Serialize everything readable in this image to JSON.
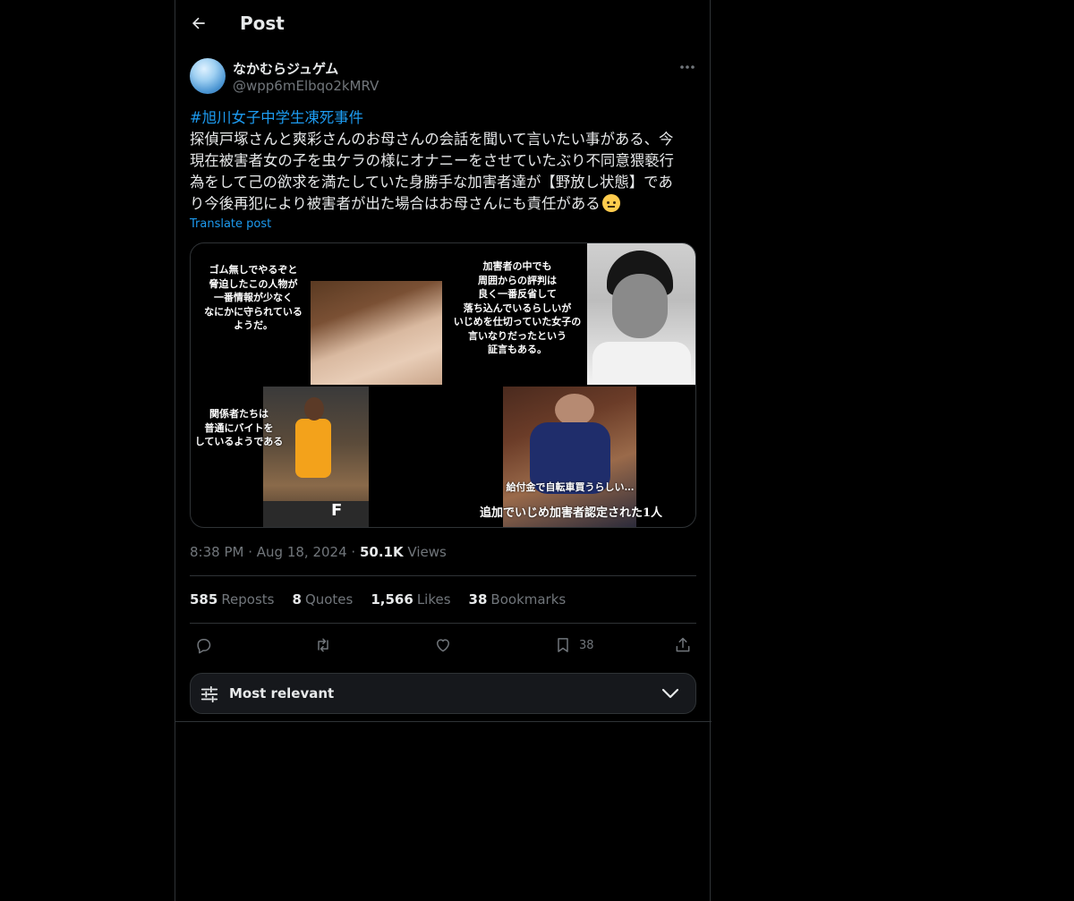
{
  "header": {
    "title": "Post"
  },
  "author": {
    "name": "なかむらジュゲム",
    "handle": "@wpp6mElbqo2kMRV"
  },
  "tweet": {
    "hashtag": "#旭川女子中学生凍死事件",
    "lines": [
      "探偵戸塚さんと爽彩さんのお母さんの会話を聞いて言いたい事がある、今",
      "現在被害者女の子を虫ケラの様にオナニーをさせていたぶり不同意猥褻行",
      "為をして己の欲求を満たしていた身勝手な加害者達が【野放し状態】であ",
      "り今後再犯により被害者が出た場合はお母さんにも責任がある"
    ],
    "translate_label": "Translate post"
  },
  "media": {
    "captions": {
      "top_left": "ゴム無しでやるぞと\n脅迫したこの人物が\n一番情報が少なく\nなにかに守られている\nようだ。",
      "top_right": "加害者の中でも\n周囲からの評判は\n良く一番反省して\n落ち込んでいるらしいが\nいじめを仕切っていた女子の\n言いなりだったという\n証言もある。",
      "bottom_left": "関係者たちは\n普通にバイトを\nしているようである",
      "bottom_right_small": "給付金で自転車買うらしい…",
      "bottom_right_big": "追加でいじめ加害者認定された1人",
      "sign_letter": "F"
    }
  },
  "meta": {
    "time": "8:38 PM",
    "date": "Aug 18, 2024",
    "views_count": "50.1K",
    "views_label": "Views"
  },
  "stats": {
    "reposts_count": "585",
    "reposts_label": "Reposts",
    "quotes_count": "8",
    "quotes_label": "Quotes",
    "likes_count": "1,566",
    "likes_label": "Likes",
    "bookmarks_count": "38",
    "bookmarks_label": "Bookmarks"
  },
  "actions": {
    "bookmark_count": "38"
  },
  "sort": {
    "label": "Most relevant"
  },
  "colors": {
    "accent": "#1d9bf0",
    "background": "#000000",
    "muted": "#71767b",
    "border": "#2f3336"
  },
  "icons": [
    "back-arrow-icon",
    "more-icon",
    "reply-icon",
    "repost-icon",
    "like-icon",
    "bookmark-icon",
    "share-icon",
    "sliders-icon",
    "chevron-down-icon"
  ]
}
